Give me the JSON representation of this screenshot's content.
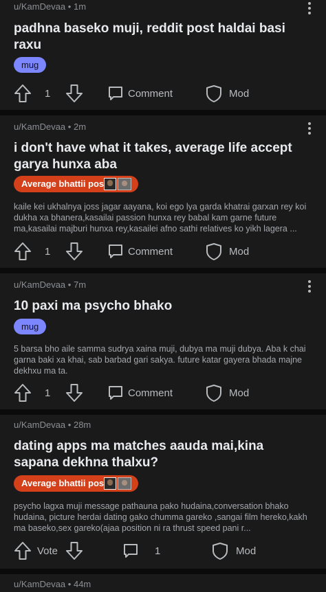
{
  "posts": [
    {
      "author": "u/KamDevaa",
      "age": "1m",
      "title": "padhna baseko muji, reddit post haldai basi raxu",
      "flair": "mug",
      "body": "",
      "vote_label": "1",
      "comment_label": "Comment",
      "mod_label": "Mod"
    },
    {
      "author": "u/KamDevaa",
      "age": "2m",
      "title": "i don't have what it takes, average life accept garya hunxa aba",
      "flair": "Average bhattii post",
      "body": "kaile kei ukhalnya joss jagar aayana, koi ego lya garda khatrai garxan rey koi dukha xa bhanera,kasailai passion hunxa rey babal kam garne future ma,kasailai majburi hunxa rey,kasailei afno sathi relatives ko yikh lagera ...",
      "vote_label": "1",
      "comment_label": "Comment",
      "mod_label": "Mod"
    },
    {
      "author": "u/KamDevaa",
      "age": "7m",
      "title": "10 paxi ma psycho bhako",
      "flair": "mug",
      "body": "5 barsa bho aile samma sudrya xaina muji, dubya ma muji dubya. Aba k chai garna baki xa khai, sab barbad gari sakya. future katar gayera bhada majne dekhxu ma ta.",
      "vote_label": "1",
      "comment_label": "Comment",
      "mod_label": "Mod"
    },
    {
      "author": "u/KamDevaa",
      "age": "28m",
      "title": "dating apps ma matches aauda mai,kina sapana dekhna thalxu?",
      "flair": "Average bhattii post",
      "body": "psycho lagxa muji message pathauna pako hudaina,conversation bhako hudaina, picture herdai dating gako chumma gareko ,sangai film hereko,kakh ma baseko,sex gareko(ajaa position ni ra thrust speed pani r...",
      "vote_label": "Vote",
      "comment_label": "1",
      "mod_label": "Mod"
    },
    {
      "author": "u/KamDevaa",
      "age": "44m"
    }
  ],
  "meta_separator": "•",
  "icons": {
    "upvote": "upvote-arrow-icon",
    "downvote": "downvote-arrow-icon",
    "comment": "comment-bubble-icon",
    "mod": "mod-shield-icon",
    "overflow": "more-vertical-icon"
  },
  "colors": {
    "background": "#0b0b0b",
    "card": "#1a1a1b",
    "mug_flair": "#7c86ff",
    "bhattii_flair": "#d4401a"
  }
}
